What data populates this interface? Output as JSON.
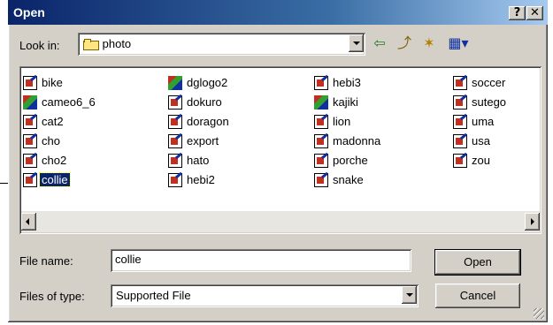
{
  "window": {
    "title": "Open",
    "help_glyph": "?",
    "close_glyph": "✕"
  },
  "lookin": {
    "label": "Look in:",
    "value": "photo"
  },
  "toolbar": {
    "back_glyph": "⇦",
    "up_glyph": "⤴",
    "new_folder_glyph": "✶",
    "view_glyph": "▦"
  },
  "files": [
    {
      "name": "bike",
      "icon": "doc"
    },
    {
      "name": "cameo6_6",
      "icon": "multi"
    },
    {
      "name": "cat2",
      "icon": "doc"
    },
    {
      "name": "cho",
      "icon": "doc"
    },
    {
      "name": "cho2",
      "icon": "doc"
    },
    {
      "name": "collie",
      "icon": "doc",
      "selected": true
    },
    {
      "name": "dglogo2",
      "icon": "multi"
    },
    {
      "name": "dokuro",
      "icon": "doc"
    },
    {
      "name": "doragon",
      "icon": "doc"
    },
    {
      "name": "export",
      "icon": "doc"
    },
    {
      "name": "hato",
      "icon": "doc"
    },
    {
      "name": "hebi2",
      "icon": "doc"
    },
    {
      "name": "hebi3",
      "icon": "doc"
    },
    {
      "name": "kajiki",
      "icon": "multi"
    },
    {
      "name": "lion",
      "icon": "doc"
    },
    {
      "name": "madonna",
      "icon": "doc"
    },
    {
      "name": "porche",
      "icon": "doc"
    },
    {
      "name": "snake",
      "icon": "doc"
    },
    {
      "name": "soccer",
      "icon": "doc"
    },
    {
      "name": "sutego",
      "icon": "doc"
    },
    {
      "name": "uma",
      "icon": "doc"
    },
    {
      "name": "usa",
      "icon": "doc"
    },
    {
      "name": "zou",
      "icon": "doc"
    }
  ],
  "filename": {
    "label": "File name:",
    "value": "collie"
  },
  "filetype": {
    "label": "Files of type:",
    "value": "Supported File"
  },
  "buttons": {
    "open": "Open",
    "cancel": "Cancel"
  }
}
